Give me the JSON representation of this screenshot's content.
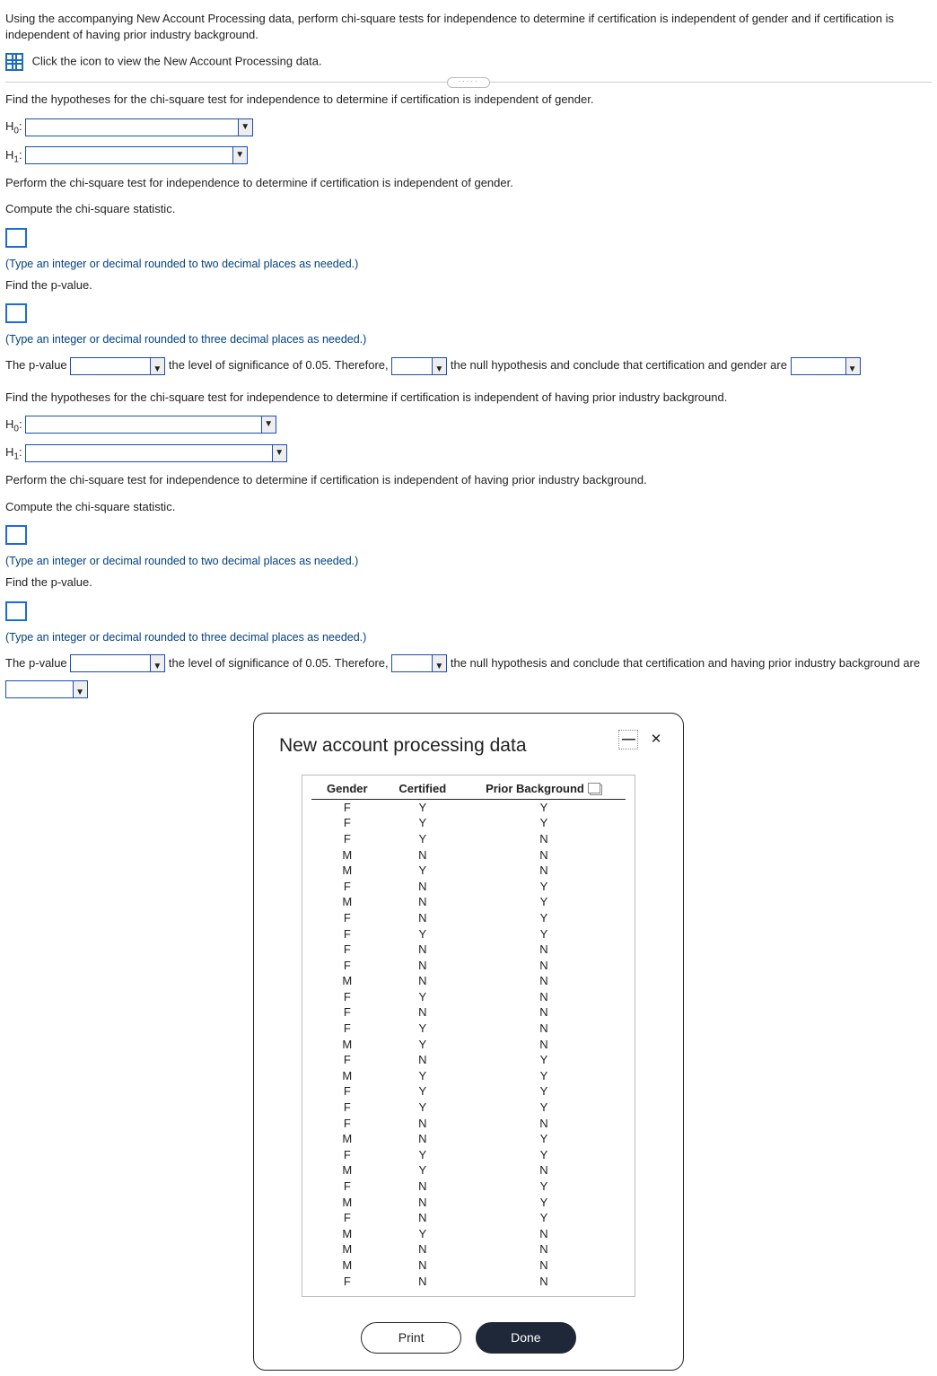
{
  "intro": {
    "text": "Using the accompanying New Account Processing data, perform chi-square tests for independence to determine if certification is independent of gender and if certification is independent of having prior industry background.",
    "icon_line": "Click the icon to view the New Account Processing data."
  },
  "q1": {
    "hyp_prompt": "Find the hypotheses for the chi-square test for independence to determine if certification is independent of gender.",
    "h0_label": "H",
    "h0_sub": "0",
    "h1_label": "H",
    "h1_sub": "1",
    "perform": "Perform the chi-square test for independence to determine if certification is independent of gender.",
    "compute": "Compute the chi-square statistic.",
    "hint2dp": "(Type an integer or decimal rounded to two decimal places as needed.)",
    "findp": "Find the p-value.",
    "hint3dp": "(Type an integer or decimal rounded to three decimal places as needed.)",
    "sent": {
      "a": "The p-value ",
      "b": " the level of significance of 0.05. Therefore, ",
      "c": " the null hypothesis and conclude that certification and gender are "
    }
  },
  "q2": {
    "hyp_prompt": "Find the hypotheses for the chi-square test for independence to determine if certification is independent of having prior industry background.",
    "perform": "Perform the chi-square test for independence to determine if certification is independent of having prior industry background.",
    "compute": "Compute the chi-square statistic.",
    "findp": "Find the p-value.",
    "sent": {
      "a": "The p-value ",
      "b": " the level of significance of 0.05. Therefore, ",
      "c": " the null hypothesis and conclude that certification and having prior industry background are "
    }
  },
  "popup": {
    "title": "New account processing data",
    "headers": [
      "Gender",
      "Certified",
      "Prior Background"
    ],
    "rows": [
      [
        "F",
        "Y",
        "Y"
      ],
      [
        "F",
        "Y",
        "Y"
      ],
      [
        "F",
        "Y",
        "N"
      ],
      [
        "M",
        "N",
        "N"
      ],
      [
        "M",
        "Y",
        "N"
      ],
      [
        "F",
        "N",
        "Y"
      ],
      [
        "M",
        "N",
        "Y"
      ],
      [
        "F",
        "N",
        "Y"
      ],
      [
        "F",
        "Y",
        "Y"
      ],
      [
        "F",
        "N",
        "N"
      ],
      [
        "F",
        "N",
        "N"
      ],
      [
        "M",
        "N",
        "N"
      ],
      [
        "F",
        "Y",
        "N"
      ],
      [
        "F",
        "N",
        "N"
      ],
      [
        "F",
        "Y",
        "N"
      ],
      [
        "M",
        "Y",
        "N"
      ],
      [
        "F",
        "N",
        "Y"
      ],
      [
        "M",
        "Y",
        "Y"
      ],
      [
        "F",
        "Y",
        "Y"
      ],
      [
        "F",
        "Y",
        "Y"
      ],
      [
        "F",
        "N",
        "N"
      ],
      [
        "M",
        "N",
        "Y"
      ],
      [
        "F",
        "Y",
        "Y"
      ],
      [
        "M",
        "Y",
        "N"
      ],
      [
        "F",
        "N",
        "Y"
      ],
      [
        "M",
        "N",
        "Y"
      ],
      [
        "F",
        "N",
        "Y"
      ],
      [
        "M",
        "Y",
        "N"
      ],
      [
        "M",
        "N",
        "N"
      ],
      [
        "M",
        "N",
        "N"
      ],
      [
        "F",
        "N",
        "N"
      ]
    ],
    "print": "Print",
    "done": "Done"
  }
}
